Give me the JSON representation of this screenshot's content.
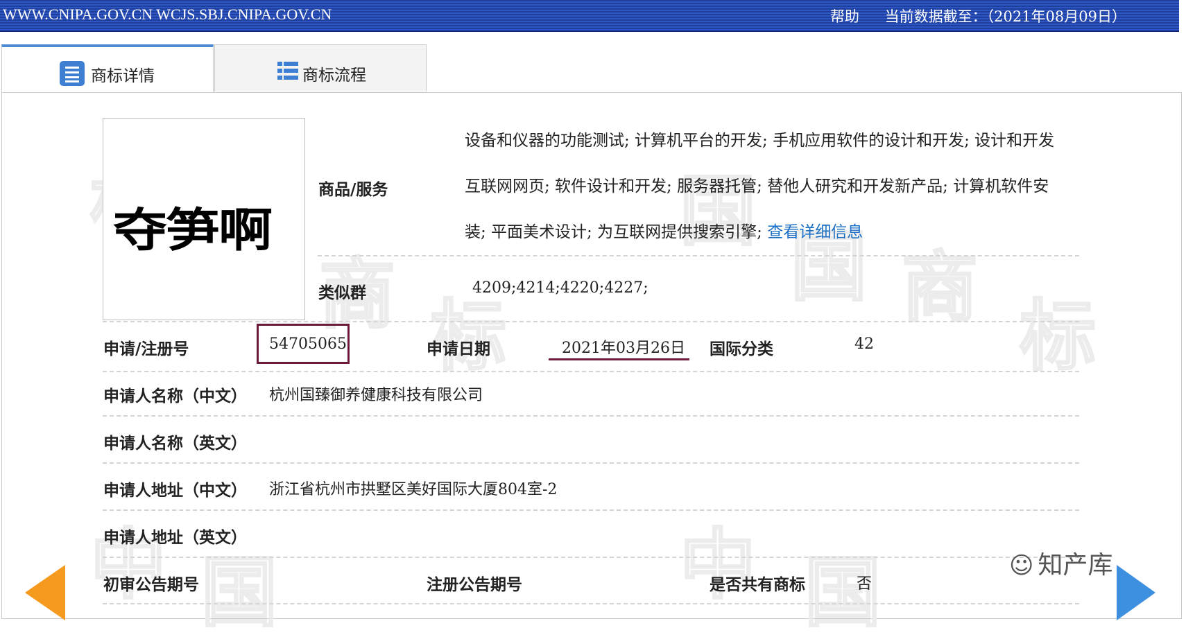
{
  "header": {
    "sites": "WWW.CNIPA.GOV.CN WCJS.SBJ.CNIPA.GOV.CN",
    "help_label": "帮助",
    "data_cutoff": "当前数据截至：（2021年08月09日）"
  },
  "tabs": [
    {
      "label": "商标详情",
      "icon": "document-list-icon",
      "active": true
    },
    {
      "label": "商标流程",
      "icon": "list-icon",
      "active": false
    }
  ],
  "trademark": {
    "image_text": "夺笋啊",
    "goods_label": "商品/服务",
    "goods_lines": [
      "设备和仪器的功能测试; 计算机平台的开发; 手机应用软件的设计和开发; 设计和开发",
      "互联网网页; 软件设计和开发; 服务器托管; 替他人研究和开发新产品; 计算机软件安",
      "装; 平面美术设计; 为互联网提供搜索引擎; "
    ],
    "goods_more_link": "查看详细信息",
    "similar_group_label": "类似群",
    "similar_group_value": "4209;4214;4220;4227;",
    "reg_no_label": "申请/注册号",
    "reg_no_value": "54705065",
    "app_date_label": "申请日期",
    "app_date_value": "2021年03月26日",
    "intl_class_label": "国际分类",
    "intl_class_value": "42",
    "applicant_cn_label": "申请人名称（中文）",
    "applicant_cn_value": "杭州国臻御养健康科技有限公司",
    "applicant_en_label": "申请人名称（英文）",
    "address_cn_label": "申请人地址（中文）",
    "address_cn_value": "浙江省杭州市拱墅区美好国际大厦804室-2",
    "address_en_label": "申请人地址（英文）",
    "prelim_pub_label": "初审公告期号",
    "reg_pub_label": "注册公告期号",
    "shared_label": "是否共有商标",
    "shared_value": "否"
  },
  "watermark": {
    "chars": [
      "中",
      "国",
      "商",
      "标"
    ],
    "account": "知产库"
  },
  "colors": {
    "banner": "#2d56c4",
    "tab_accent": "#4c8ad4",
    "link": "#1a6fc4",
    "highlight": "#6b1a3a",
    "arrow_left": "#f59a1f",
    "arrow_right": "#3d8fe0"
  }
}
